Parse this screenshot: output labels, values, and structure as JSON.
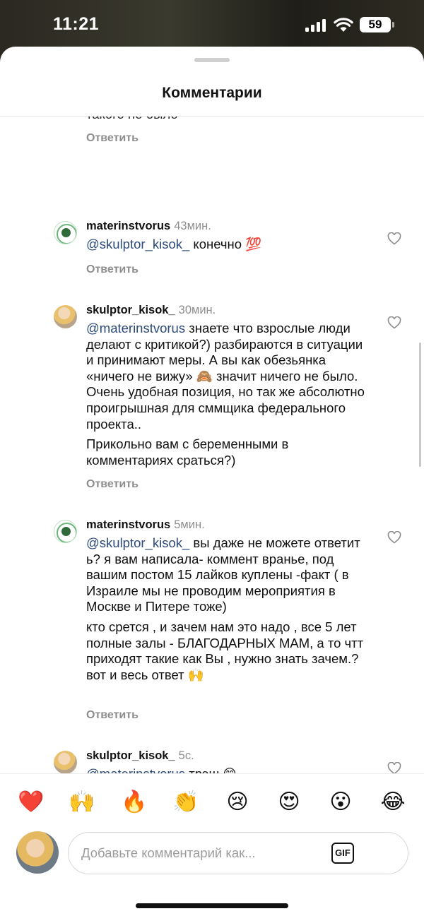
{
  "status_bar": {
    "time": "11:21",
    "battery": "59"
  },
  "sheet": {
    "title": "Комментарии"
  },
  "comments": {
    "reply_label": "Ответить",
    "cut_text": "такого не было",
    "c1": {
      "username": "materinstvorus",
      "time": "43мин.",
      "mention": "@skulptor_kisok_",
      "text": " конечно 💯"
    },
    "c2": {
      "username": "skulptor_kisok_",
      "time": "30мин.",
      "mention": "@materinstvorus",
      "text": " знаете что взрослые люди делают с критикой?) разбираются в ситуации и принимают меры. А вы как обезьянка «ничего не вижу» 🙈 значит ничего не было. Очень удобная позиция, но так же абсолютно проигрышная для сммщика федерального проекта..",
      "text2": "Прикольно вам с беременными в комментариях сраться?)"
    },
    "c3": {
      "username": "materinstvorus",
      "time": "5мин.",
      "mention": "@skulptor_kisok_",
      "text": " вы даже  не можете ответит ь? я вам написала- коммент вранье, под вашим постом 15 лайков куплены -факт ( в Израиле мы не проводим мероприятия в Москве и Питере тоже)",
      "text2": "кто срется , и зачем нам это надо , все 5 лет полные залы - БЛАГОДАРНЫХ МАМ, а то чтт приходят такие как Вы , нужно знать зачем.? вот и весь ответ 🙌"
    },
    "c4": {
      "username": "skulptor_kisok_",
      "time": "5с.",
      "mention": "@materinstvorus",
      "text": " трэш 😁"
    }
  },
  "reactions": [
    "❤️",
    "🙌",
    "🔥",
    "👏",
    "😢",
    "😍",
    "😮",
    "😂"
  ],
  "composer": {
    "placeholder": "Добавьте комментарий как...",
    "gif_label": "GIF"
  },
  "icons": {
    "like": "heart-outline-icon",
    "gif": "gif-icon",
    "signal": "cellular-signal-icon",
    "wifi": "wifi-icon",
    "battery": "battery-icon"
  },
  "colors": {
    "mention": "#2c4a7a",
    "secondary_text": "#8e8e8e",
    "heart": "#e0141e"
  }
}
